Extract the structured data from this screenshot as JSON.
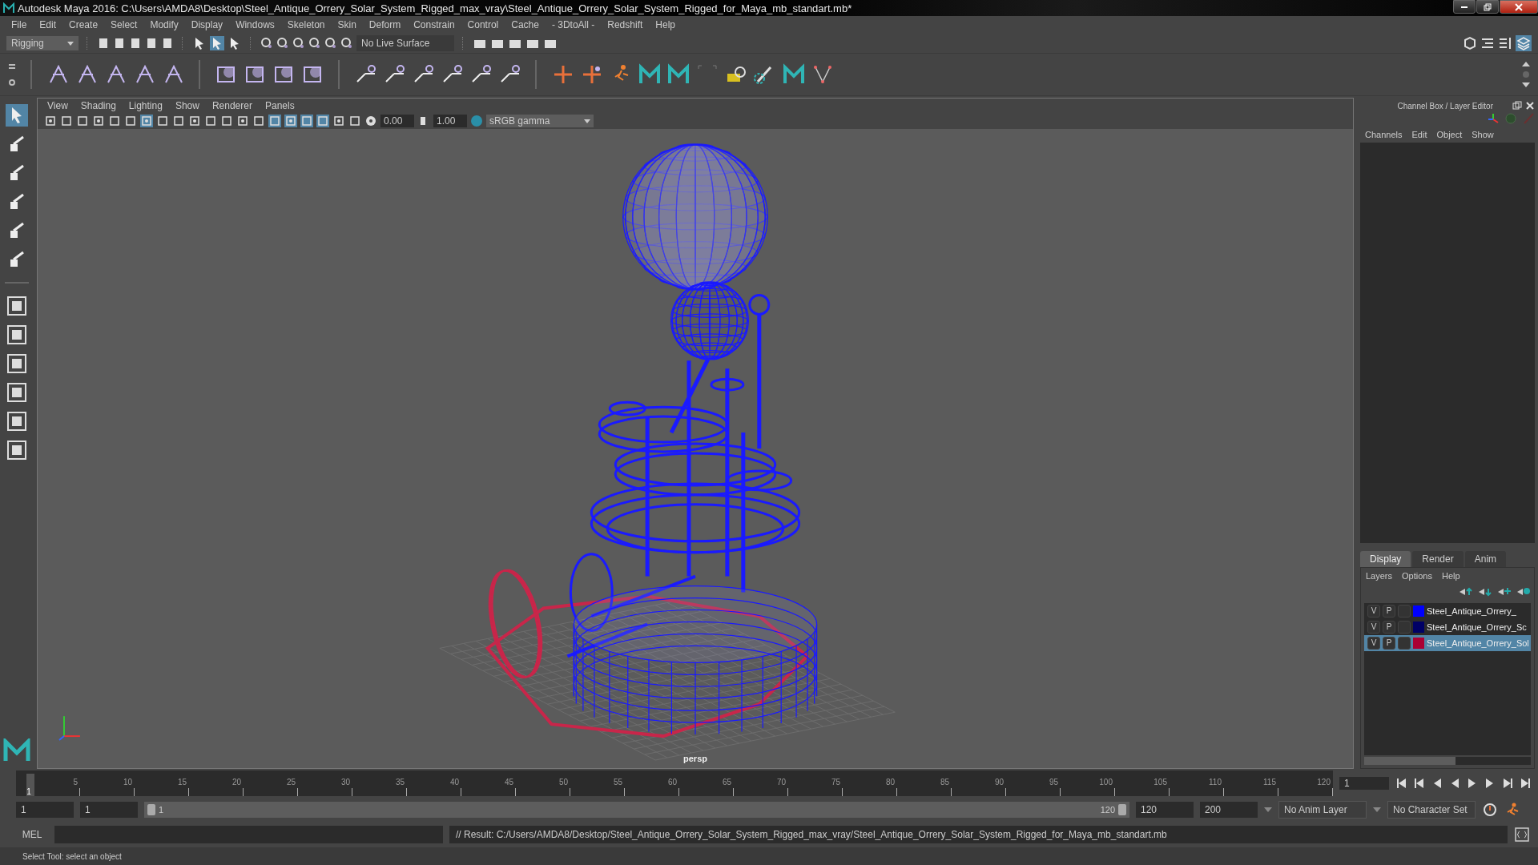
{
  "window": {
    "title": "Autodesk Maya 2016: C:\\Users\\AMDA8\\Desktop\\Steel_Antique_Orrery_Solar_System_Rigged_max_vray\\Steel_Antique_Orrery_Solar_System_Rigged_for_Maya_mb_standart.mb*"
  },
  "menu_bar": [
    "File",
    "Edit",
    "Create",
    "Select",
    "Modify",
    "Display",
    "Windows",
    "Skeleton",
    "Skin",
    "Deform",
    "Constrain",
    "Control",
    "Cache",
    "- 3DtoAll -",
    "Redshift",
    "Help"
  ],
  "status_line": {
    "mode": "Rigging",
    "live_surface": "No Live Surface"
  },
  "viewport": {
    "menus": [
      "View",
      "Shading",
      "Lighting",
      "Show",
      "Renderer",
      "Panels"
    ],
    "exposure": "0.00",
    "gamma": "1.00",
    "color_space": "sRGB gamma",
    "camera": "persp"
  },
  "channel_box": {
    "title": "Channel Box / Layer Editor",
    "menus": [
      "Channels",
      "Edit",
      "Object",
      "Show"
    ]
  },
  "layer_editor": {
    "tabs": [
      {
        "label": "Display",
        "selected": true
      },
      {
        "label": "Render",
        "selected": false
      },
      {
        "label": "Anim",
        "selected": false
      }
    ],
    "menus": [
      "Layers",
      "Options",
      "Help"
    ],
    "layers": [
      {
        "visible": "V",
        "playback": "P",
        "name": "Steel_Antique_Orrery_",
        "color": "#0000ff",
        "selected": false
      },
      {
        "visible": "V",
        "playback": "P",
        "name": "Steel_Antique_Orrery_Sc",
        "color": "#000066",
        "selected": false
      },
      {
        "visible": "V",
        "playback": "P",
        "name": "Steel_Antique_Orrery_Sol",
        "color": "#aa0033",
        "selected": true
      }
    ]
  },
  "time_slider": {
    "ticks": [
      "5",
      "10",
      "15",
      "20",
      "25",
      "30",
      "35",
      "40",
      "45",
      "50",
      "55",
      "60",
      "65",
      "70",
      "75",
      "80",
      "85",
      "90",
      "95",
      "100",
      "105",
      "110",
      "115",
      "120"
    ],
    "current_frame": "1",
    "current_field": "1",
    "level": 0.008
  },
  "range_slider": {
    "level": 1,
    "start": "1",
    "playback_start": "1",
    "range_start": "1",
    "range_end": "120",
    "playback_end": "120",
    "end": "200",
    "anim_layer": "No Anim Layer",
    "character_set": "No Character Set"
  },
  "command_line": {
    "language": "MEL",
    "result": "// Result: C:/Users/AMDA8/Desktop/Steel_Antique_Orrery_Solar_System_Rigged_max_vray/Steel_Antique_Orrery_Solar_System_Rigged_for_Maya_mb_standart.mb"
  },
  "help_line": "Select Tool: select an object"
}
